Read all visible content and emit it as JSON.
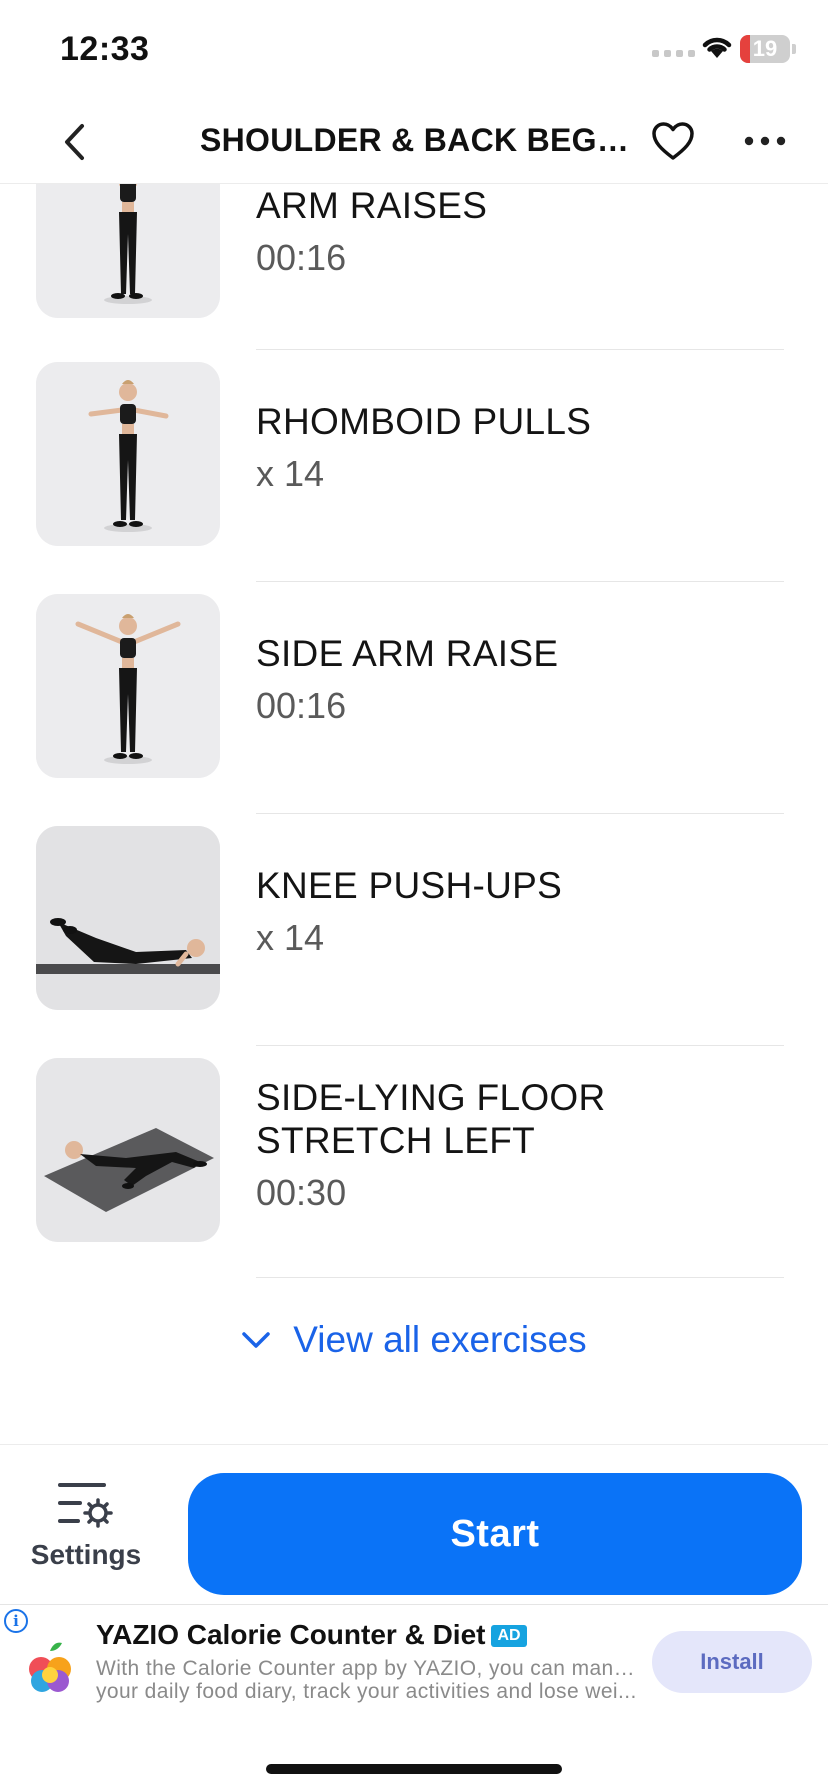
{
  "status_bar": {
    "time": "12:33",
    "battery_level": "19",
    "battery_fraction": 0.19
  },
  "nav": {
    "title": "SHOULDER & BACK BEGIN...",
    "back_icon": "chevron-left-icon",
    "favorite_icon": "heart-outline-icon",
    "more_icon": "ellipsis-icon"
  },
  "exercises": [
    {
      "name": "ARM RAISES",
      "meta": "00:16",
      "pose": "arms-up"
    },
    {
      "name": "RHOMBOID PULLS",
      "meta": "x 14",
      "pose": "arms-forward"
    },
    {
      "name": "SIDE ARM RAISE",
      "meta": "00:16",
      "pose": "arms-side"
    },
    {
      "name": "KNEE PUSH-UPS",
      "meta": "x 14",
      "pose": "pushup"
    },
    {
      "name": "SIDE-LYING FLOOR STRETCH LEFT",
      "name_line1": "SIDE-LYING FLOOR",
      "name_line2": "STRETCH LEFT",
      "meta": "00:30",
      "pose": "floor-stretch"
    }
  ],
  "view_all": {
    "label": "View all exercises"
  },
  "bottom_bar": {
    "settings_label": "Settings",
    "start_label": "Start"
  },
  "ad": {
    "title": "YAZIO Calorie Counter & Diet",
    "badge": "AD",
    "description_line1": "With the Calorie Counter app by YAZIO, you can manage",
    "description_line2": "your daily food diary, track your activities and lose wei...",
    "install_label": "Install"
  },
  "colors": {
    "accent_blue": "#0a73f7",
    "link_blue": "#1a63e8",
    "battery_red": "#e5413d"
  }
}
